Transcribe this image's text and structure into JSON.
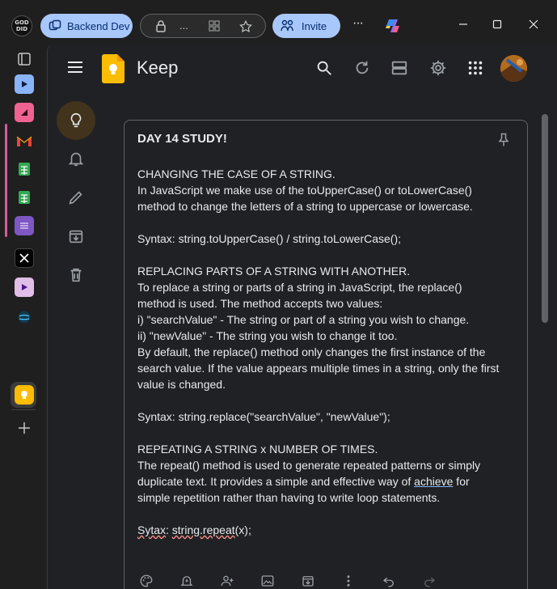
{
  "browser": {
    "profile_label_top": "GOD",
    "profile_label_bottom": "DID",
    "workspace_label": "Backend Dev",
    "address_ellipsis": "...",
    "invite_label": "Invite",
    "more_label": "···"
  },
  "sidebar": {
    "items": [
      {
        "name": "sidebar-tabs-icon"
      },
      {
        "name": "sidebar-app-blue"
      },
      {
        "name": "sidebar-app-pink"
      },
      {
        "name": "sidebar-gmail"
      },
      {
        "name": "sidebar-sheets-1"
      },
      {
        "name": "sidebar-sheets-2"
      },
      {
        "name": "sidebar-app-purple"
      },
      {
        "name": "sidebar-x"
      },
      {
        "name": "sidebar-app-pink-2"
      },
      {
        "name": "sidebar-app-globe"
      },
      {
        "name": "sidebar-keep"
      },
      {
        "name": "sidebar-add"
      }
    ]
  },
  "keep": {
    "title": "Keep"
  },
  "note": {
    "title": "DAY 14 STUDY!",
    "lines": [
      "CHANGING THE CASE OF A STRING.",
      "In JavaScript we make use of the toUpperCase() or toLowerCase()",
      "method to change the letters of a string to uppercase or lowercase.",
      "",
      "Syntax: string.toUpperCase() / string.toLowerCase();",
      "",
      "REPLACING PARTS OF A STRING WITH ANOTHER.",
      "To replace a string or parts of a string in JavaScript, the replace()",
      "method is used. The method accepts two values:",
      "i) \"searchValue\" - The string or part of a string you wish to change.",
      "ii) \"newValue\" - The string you wish to change it too.",
      "By default, the replace() method only changes the first instance of the",
      "search value. If the value appears multiple times in a string, only the first",
      "value is changed.",
      "",
      "Syntax: string.replace(\"searchValue\", \"newValue\");",
      "",
      "REPEATING A STRING x NUMBER OF TIMES.",
      "The repeat() method is used to generate repeated patterns or simply",
      "duplicate text. It provides a simple and effective way of achieve for",
      "simple repetition rather than having to write loop statements.",
      ""
    ],
    "last_line_a": "Sytax",
    "last_line_b": ": ",
    "last_line_c": "string.repeat",
    "last_line_d": "(x)",
    "last_line_e": ";"
  }
}
